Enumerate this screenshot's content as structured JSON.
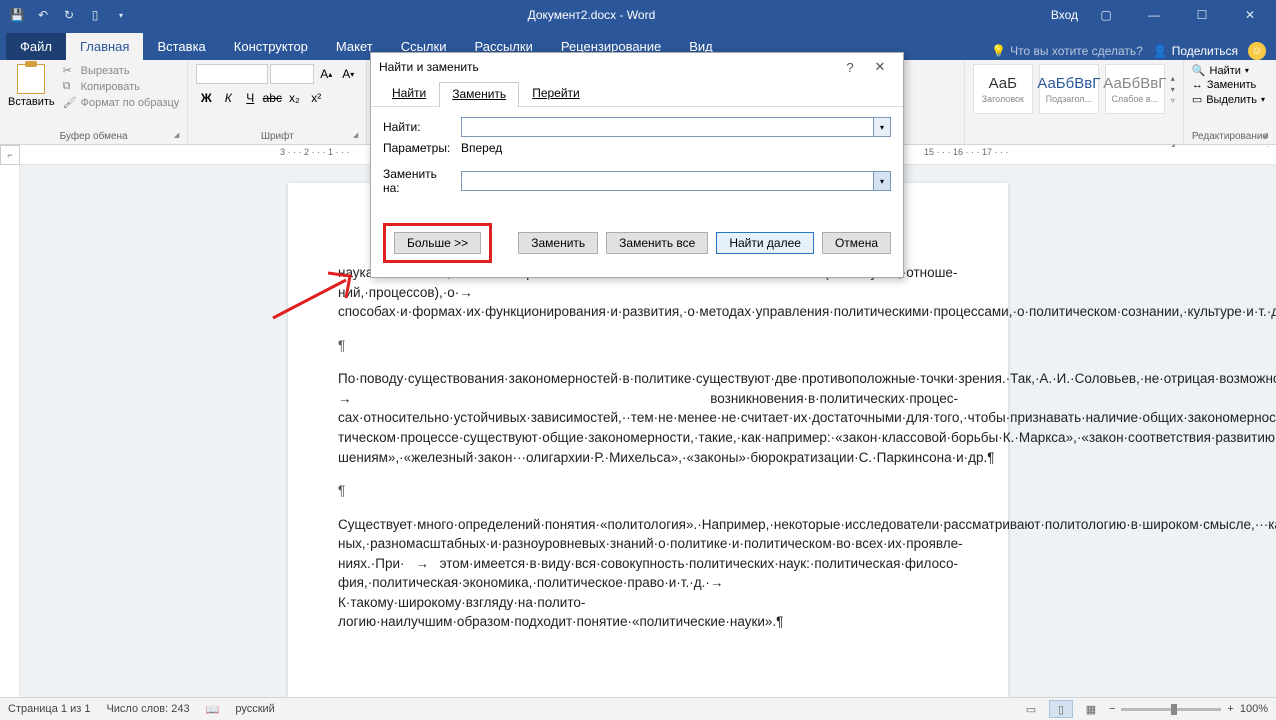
{
  "titlebar": {
    "doc_title": "Документ2.docx - Word",
    "login": "Вход"
  },
  "ribbon": {
    "tabs": [
      "Файл",
      "Главная",
      "Вставка",
      "Конструктор",
      "Макет",
      "Ссылки",
      "Рассылки",
      "Рецензирование",
      "Вид"
    ],
    "tell_me": "Что вы хотите сделать?",
    "share": "Поделиться",
    "paste": "Вставить",
    "cut": "Вырезать",
    "copy": "Копировать",
    "format_painter": "Формат по образцу",
    "group_clipboard": "Буфер обмена",
    "group_font": "Шрифт",
    "styles": {
      "heading": "Заголовок",
      "sub": "Подзагол...",
      "subtle": "Слабое в...",
      "preview1": "АаБ",
      "preview2": "АаБбВвГ",
      "preview3": "АаБбВвГ"
    },
    "editing": {
      "find": "Найти",
      "replace": "Заменить",
      "select": "Выделить",
      "group": "Редактирование"
    }
  },
  "ruler_right_segment": "15 · · · 16 · · · 17 · · ·",
  "ruler_left_segment": "3 · · · 2 · · · 1 · · ·",
  "dialog": {
    "title": "Найти и заменить",
    "tabs": {
      "find": "Найти",
      "replace": "Заменить",
      "goto": "Перейти"
    },
    "find_label": "Найти:",
    "params_label": "Параметры:",
    "params_value": "Вперед",
    "replace_label": "Заменить на:",
    "find_value": "",
    "replace_value": "",
    "btn_more": "Больше >>",
    "btn_replace": "Заменить",
    "btn_replace_all": "Заменить все",
    "btn_find_next": "Найти далее",
    "btn_cancel": "Отмена"
  },
  "document": {
    "p1": "наука·о·политике,·о·закономерностях·возникновения·политических·явлений·(институтов,·отноше­ний,·процессов),·о·→ способах·и·формах·их·функционирования·и·развития,·о·методах·управления·политическими·процессами,·о·политическом·сознании,·культуре·и·т.·д.¶",
    "p_empty1": "¶",
    "p2": "По·поводу·существования·закономерностей·в·политике·существуют·две·противоположные·точки·зрения.·Так,·А.·И.·Соловьев,·не·отрицая·возможности· → возникновения·в·политических·процес­сах·относительно·устойчивых·зависимостей,··тем·не·менее·не·считает·их·достаточными·для·того,·чтобы·признавать·наличие·общих·закономерностей·в·политике.·Сторонники·другой·точки·зрения·(В.·А.·Ачкасов,·В.·А.·Гуторов,·В.·А.·Мальцев,·Н.·М.·Марченко,·В.·В.·Желто·в·и·др.)·считают,·что·в·поли­тическом·процессе·существуют·общие·закономерности,·такие,·как·например:·«закон·классовой·борьбы·К.·Маркса»,·«закон·соответствия·развитию·уровня·производства·производственным·отно­шениям»,·«железный·закон···олигархии·Р.·Михельса»,·«законы»·бюрократизации·С.·Паркинсона·и·др.¶",
    "p_empty2": "¶",
    "p3": "Существует·много·определений·понятия·«политология».·Например,·некоторые·исследователи·рассматривают·политологию·в·широком·смысле,···как·науку,·изучающую·совокупность·разнород­ных,·разномасштабных·и·разноуровневых·знаний·о·политике·и·политическом·во·всех·их·проявле­ниях.·При· → этом·имеется·в·виду·вся·совокупность·политических·наук:·политическая·филосо­фия,·политическая·экономика,·политическое·право·и·т.·д.·→ К·такому·широкому·взгляду·на·полито­логию·наилучшим·образом·подходит·понятие·«политические·науки».¶"
  },
  "statusbar": {
    "page": "Страница 1 из 1",
    "words": "Число слов: 243",
    "lang": "русский",
    "zoom": "100%"
  }
}
